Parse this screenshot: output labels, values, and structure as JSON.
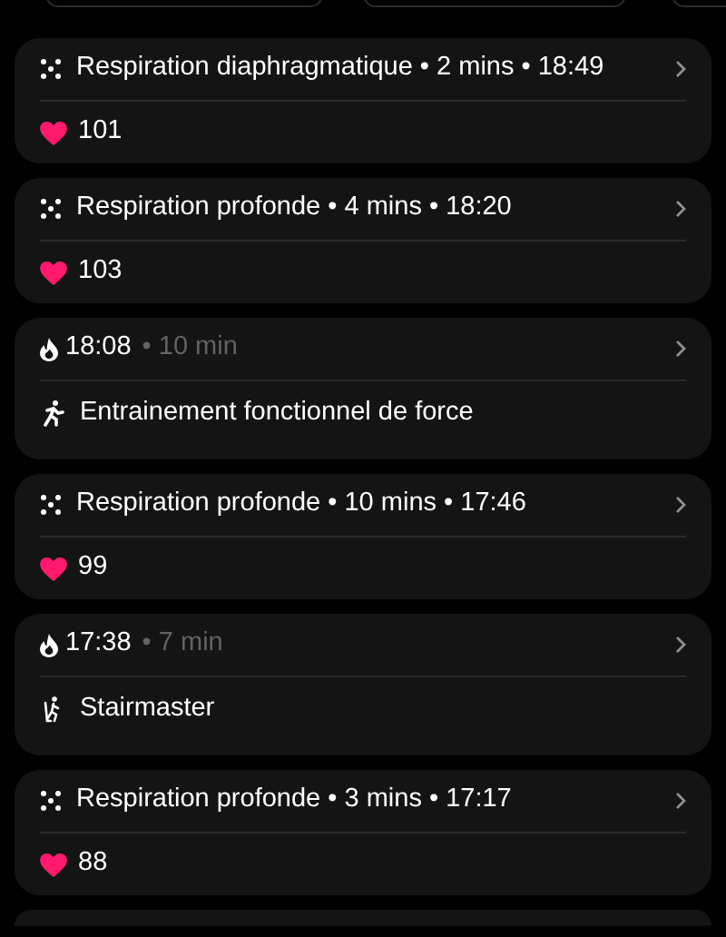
{
  "entries": [
    {
      "kind": "mindfulness",
      "title": "Respiration diaphragmatique • 2 mins • 18:49",
      "heart_rate": "101"
    },
    {
      "kind": "mindfulness",
      "title": "Respiration profonde • 4 mins • 18:20",
      "heart_rate": "103"
    },
    {
      "kind": "workout",
      "time": "18:08",
      "duration": "• 10 min",
      "activity": {
        "kind": "strength",
        "label": "Entrainement fonctionnel de force"
      }
    },
    {
      "kind": "mindfulness",
      "title": "Respiration profonde • 10 mins • 17:46",
      "heart_rate": "99"
    },
    {
      "kind": "workout",
      "time": "17:38",
      "duration": "• 7 min",
      "activity": {
        "kind": "stairs",
        "label": "Stairmaster"
      }
    },
    {
      "kind": "mindfulness",
      "title": "Respiration profonde • 3 mins • 17:17",
      "heart_rate": "88"
    },
    {
      "kind": "partial"
    }
  ]
}
